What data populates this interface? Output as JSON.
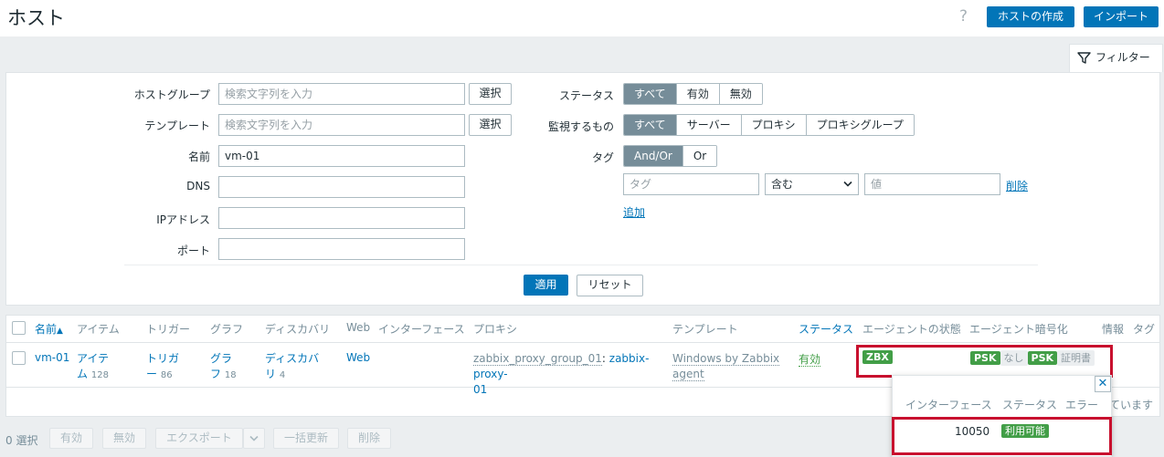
{
  "header": {
    "title": "ホスト",
    "help": "?",
    "create_host": "ホストの作成",
    "import": "インポート"
  },
  "filter": {
    "tab_label": "フィルター",
    "host_group": {
      "label": "ホストグループ",
      "placeholder": "検索文字列を入力",
      "select": "選択"
    },
    "template": {
      "label": "テンプレート",
      "placeholder": "検索文字列を入力",
      "select": "選択"
    },
    "name": {
      "label": "名前",
      "value": "vm-01"
    },
    "dns": {
      "label": "DNS",
      "value": ""
    },
    "ip": {
      "label": "IPアドレス",
      "value": ""
    },
    "port": {
      "label": "ポート",
      "value": ""
    },
    "status": {
      "label": "ステータス",
      "options": [
        "すべて",
        "有効",
        "無効"
      ],
      "selected": "すべて"
    },
    "monitored_by": {
      "label": "監視するもの",
      "options": [
        "すべて",
        "サーバー",
        "プロキシ",
        "プロキシグループ"
      ],
      "selected": "すべて"
    },
    "tags": {
      "label": "タグ",
      "options": [
        "And/Or",
        "Or"
      ],
      "selected": "And/Or",
      "tag_placeholder": "タグ",
      "operator": "含む",
      "value_placeholder": "値",
      "remove": "削除",
      "add": "追加"
    },
    "apply": "適用",
    "reset": "リセット"
  },
  "table": {
    "headers": [
      "名前",
      "アイテム",
      "トリガー",
      "グラフ",
      "ディスカバリ",
      "Web",
      "インターフェース",
      "プロキシ",
      "テンプレート",
      "ステータス",
      "エージェントの状態",
      "エージェント暗号化",
      "情報",
      "タグ"
    ],
    "sort_indicator": "▲",
    "rows": [
      {
        "name": "vm-01",
        "items_line1": "アイテ",
        "items_line2": "ム",
        "items_count": "128",
        "triggers_line1": "トリガ",
        "triggers_line2": "ー",
        "triggers_count": "86",
        "graphs_line1": "グラ",
        "graphs_line2": "フ",
        "graphs_count": "18",
        "discovery_line1": "ディスカバ",
        "discovery_line2": "リ",
        "discovery_count": "4",
        "web": "Web",
        "proxy_group": "zabbix_proxy_group_01",
        "proxy_line1": "zabbix-proxy-",
        "proxy_line2": "01",
        "template_line1": "Windows by Zabbix",
        "template_line2": "agent",
        "status": "有効",
        "availability": "ZBX",
        "encryption": [
          "PSK",
          "なし",
          "PSK",
          "証明書"
        ]
      }
    ],
    "trailing_text": "ています"
  },
  "popup": {
    "close": "✕",
    "headers": [
      "インターフェース",
      "ステータス",
      "エラー"
    ],
    "port": "10050",
    "status": "利用可能"
  },
  "footer": {
    "selected": "0 選択",
    "enable": "有効",
    "disable": "無効",
    "export": "エクスポート",
    "mass_update": "一括更新",
    "delete": "削除"
  },
  "colors": {
    "primary": "#0275b8",
    "green": "#429e47",
    "highlight": "#c8102e"
  }
}
